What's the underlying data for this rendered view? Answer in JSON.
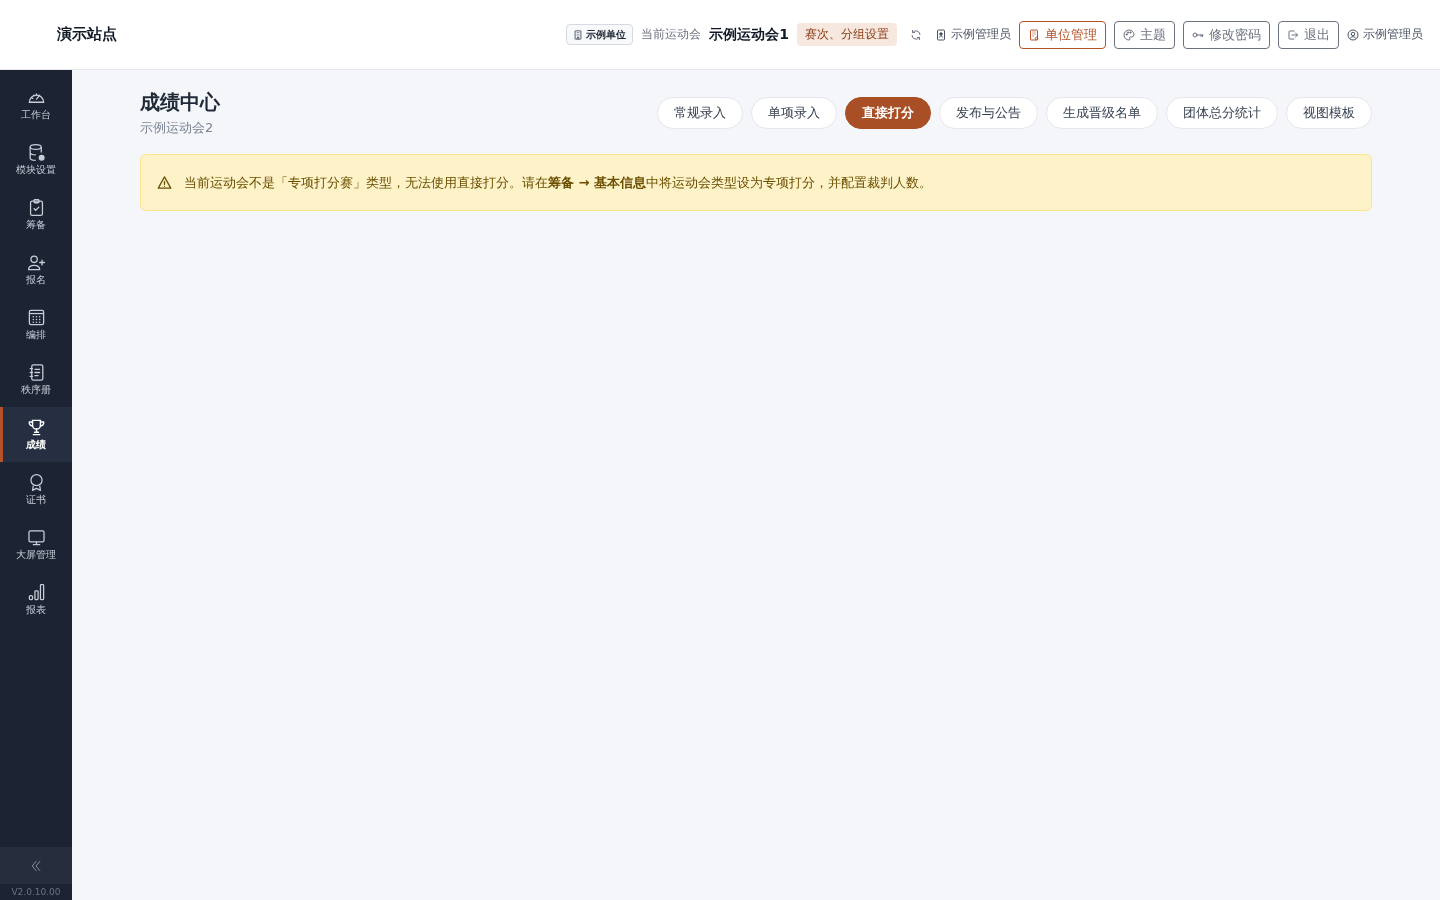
{
  "header": {
    "site_name": "演示站点",
    "unit_badge": "示例单位",
    "current_meet_label": "当前运动会",
    "current_meet": "示例运动会1",
    "meet_settings": "赛次、分组设置",
    "admin_name": "示例管理员",
    "buttons": [
      {
        "label": "单位管理",
        "kind": "unit",
        "highlighted": true
      },
      {
        "label": "主题",
        "kind": "theme",
        "highlighted": false
      },
      {
        "label": "修改密码",
        "kind": "password",
        "highlighted": false
      },
      {
        "label": "退出",
        "kind": "logout",
        "highlighted": false
      }
    ],
    "user_name": "示例管理员"
  },
  "sidebar": {
    "items": [
      {
        "label": "工作台",
        "kind": "gauge",
        "selected": false
      },
      {
        "label": "模块设置",
        "kind": "database",
        "selected": false
      },
      {
        "label": "筹备",
        "kind": "clipboard",
        "selected": false
      },
      {
        "label": "报名",
        "kind": "user-plus",
        "selected": false
      },
      {
        "label": "编排",
        "kind": "calendar",
        "selected": false
      },
      {
        "label": "秩序册",
        "kind": "notebook",
        "selected": false
      },
      {
        "label": "成绩",
        "kind": "trophy",
        "selected": true
      },
      {
        "label": "证书",
        "kind": "award",
        "selected": false
      },
      {
        "label": "大屏管理",
        "kind": "monitor",
        "selected": false
      },
      {
        "label": "报表",
        "kind": "chart",
        "selected": false
      }
    ],
    "version": "V2.0.10.00"
  },
  "page": {
    "title": "成绩中心",
    "subtitle": "示例运动会2",
    "tabs": [
      {
        "label": "常规录入",
        "selected": false
      },
      {
        "label": "单项录入",
        "selected": false
      },
      {
        "label": "直接打分",
        "selected": true
      },
      {
        "label": "发布与公告",
        "selected": false
      },
      {
        "label": "生成晋级名单",
        "selected": false
      },
      {
        "label": "团体总分统计",
        "selected": false
      },
      {
        "label": "视图模板",
        "selected": false
      }
    ]
  },
  "alert": {
    "kind": "warning",
    "text": "当前运动会不是「专项打分赛」类型，无法使用直接打分。请在**筹备 → 基本信息**中将运动会类型设为专项打分，并配置裁判人数。"
  }
}
